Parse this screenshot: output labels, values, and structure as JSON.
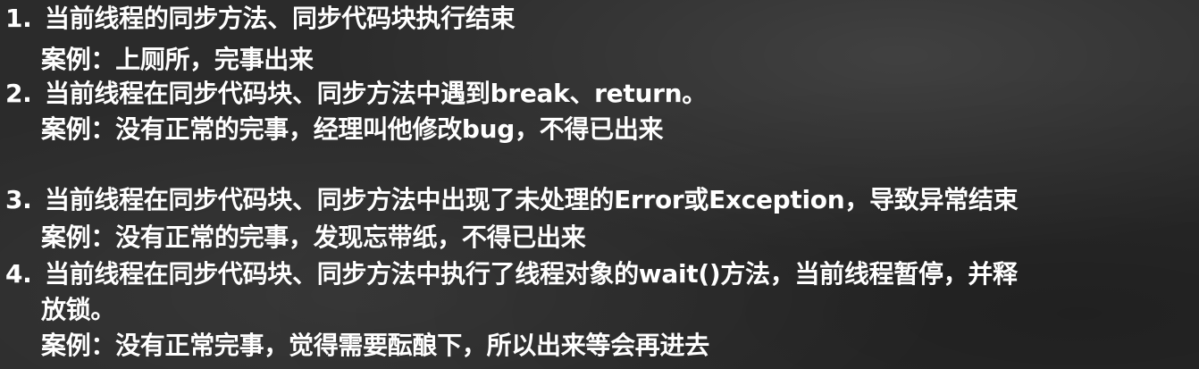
{
  "items": [
    {
      "number": "1.",
      "text": "当前线程的同步方法、同步代码块执行结束",
      "example": "案例：上厕所，完事出来"
    },
    {
      "number": "2.",
      "text": "当前线程在同步代码块、同步方法中遇到break、return。",
      "example": "案例：没有正常的完事，经理叫他修改bug，不得已出来"
    },
    {
      "number": "3.",
      "text": "当前线程在同步代码块、同步方法中出现了未处理的Error或Exception，导致异常结束",
      "example": "案例：没有正常的完事，发现忘带纸，不得已出来"
    },
    {
      "number": "4.",
      "text": "当前线程在同步代码块、同步方法中执行了线程对象的wait()方法，当前线程暂停，并释",
      "text_continued": "放锁。",
      "example": "案例：没有正常完事，觉得需要酝酿下，所以出来等会再进去"
    }
  ]
}
